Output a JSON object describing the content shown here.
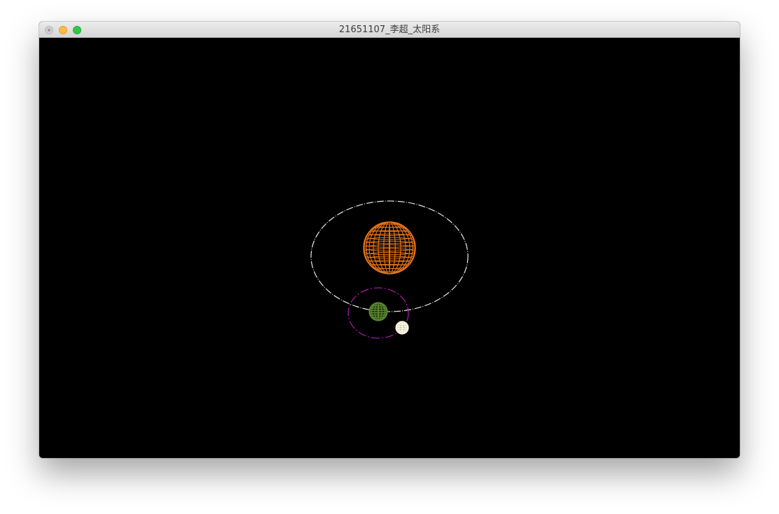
{
  "window": {
    "title": "21651107_李超_太阳系"
  },
  "scene": {
    "background_color": "#000000",
    "sun": {
      "color": "#e8751a"
    },
    "earth": {
      "color": "#4f7a2a"
    },
    "moon": {
      "color": "#f3efd6"
    },
    "earth_orbit": {
      "color": "#ffffff",
      "style": "dashed"
    },
    "moon_orbit": {
      "color": "#c21bc2",
      "style": "dashed"
    }
  },
  "icons": {
    "close": "close-button-icon",
    "minimize": "minimize-button-icon",
    "zoom": "zoom-button-icon"
  }
}
